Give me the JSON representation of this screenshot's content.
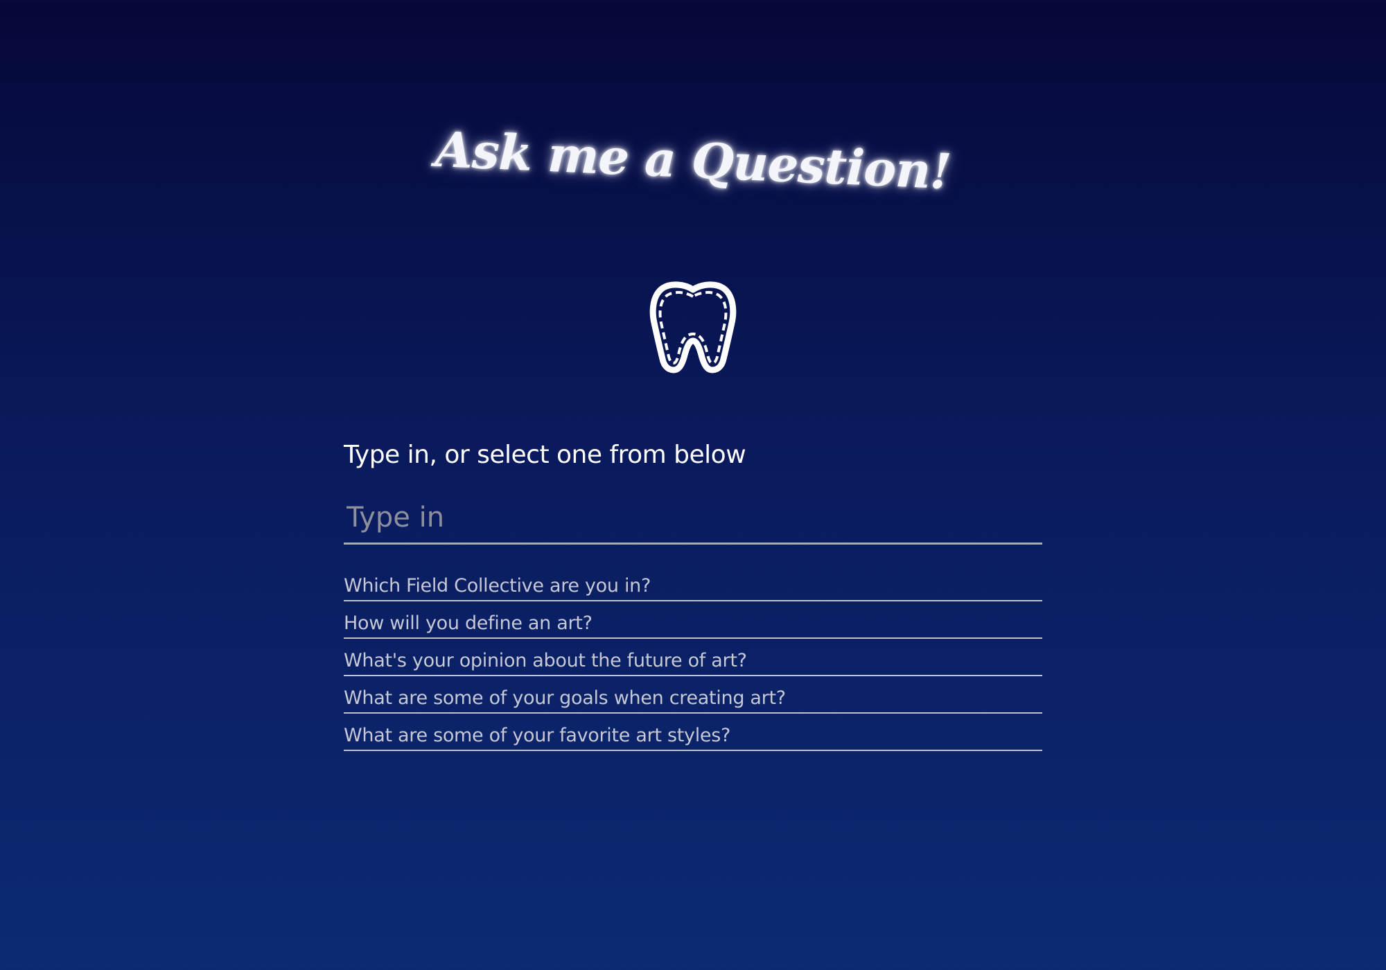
{
  "page": {
    "title": "Ask me a Question!"
  },
  "icon": {
    "name": "tooth-icon"
  },
  "form": {
    "prompt": "Type in, or select one from below",
    "input_placeholder": "Type in",
    "input_value": "",
    "options": [
      "Which Field Collective are you in?",
      "How will you define an art?",
      "What's your opinion about the future of art?",
      "What are some of your goals when creating art?",
      "What are some of your favorite art styles?"
    ]
  },
  "colors": {
    "background_top": "#050838",
    "background_bottom": "#0c2a72",
    "text": "#ffffff",
    "option_text": "#c6c8d6",
    "underline": "#a9abb5"
  }
}
